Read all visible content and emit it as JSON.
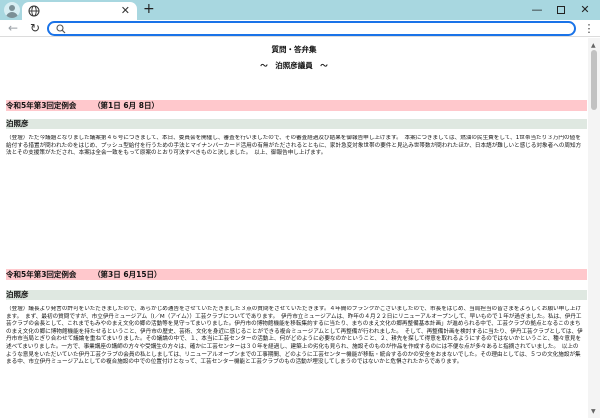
{
  "browser": {
    "tab_title": "",
    "tab_close": "✕",
    "new_tab": "+",
    "min": "—",
    "close": "✕",
    "back": "←",
    "reload": "↻",
    "menu": "⋮",
    "url_value": "",
    "icons": [
      "profile-icon",
      "globe-icon",
      "search-icon"
    ],
    "accent": "#1a73e8",
    "tabbar_color": "#a8d7e0"
  },
  "page": {
    "title": "質問・答弁集",
    "subtitle": "～　泊照彦議員　～",
    "colors": {
      "session_bg": "#ffc8cc",
      "speaker_bg": "#dfe8e1"
    },
    "sections": [
      {
        "session": "令和5年第3回定例会",
        "date": "（第1日 6月 8日）",
        "speaker": "泊照彦",
        "text": "（登壇）ただ今議題となりました議案第４６号につきまして、本日、委員会を開催し、審査を行いましたので、その審査経過及び結果を御報告申し上げます。　本案につきましては、燃油の民生費をして、1世帯当たり３万円の値を給付する措置が問われたのをはじめ、プッシュ型給付を行うための手法とマイナンバーカード活用の有無がただされるとともに、家計急変対象世帯の要件と見込み世帯数が問われたほか、日本語が難しいと感じる対象者への周知方法とその支援策がただされ、本案は全会一致をもって原案のとおり可決すべきものと決しました。　以上、御報告申し上げます。"
      },
      {
        "session": "令和5年第3回定例会",
        "date": "（第3日 6月15日）",
        "speaker": "泊照彦",
        "text": "（登壇）議長より発言の許可をいただきましたので、あらかじめ通告をさせていただきました３点の質問をさせていただきます。４年間のブランクがございましたので、市長をはじめ、当局担当の皆さまをよろしくお願い申し上げます。　まず、最初の質問ですが、市立伊丹ミュージアム（I／M（アイム））工芸クラブについてであります。　伊丹市立ミュージアムは、昨年の４月２２日にリニューアルオープンして、早いもので１年が過ぎました。私は、伊丹工芸クラブの会長として、これまでもみやのまえ文化の郷の活動等を見守ってまいりました。伊丹市の博物館機能を移転集約するに当たり、まちのまえ文化の郷再整備基本計画」が進められる中で、工芸クラブの拠点となるこのまちのまえ文化の郷に博物館機能を持たせるということ、伊丹市の歴史、芸術、文化を身近に感じることができる複合ミュージアムとして再整備が行われました。　そして、再整備計画を検討するに当たり、伊丹工芸クラブとしては、伊丹市市当局とぎり合わせて議論を重ねてまいりました。その議論の中で、１、本当に工芸センターの活動上、何がどのように必要なのかということ、２、耕先を探して得意を取れるようにするのではないかということ、種々意見を述べてまいりました。一方で、事業講座の講師の方々や受講生の方々は、確かに工芸センターは３０年を経過し、建築上の劣化も見られ、施設そのものが作品を作成するのには不便な点が多々あると指摘されていました。　以上のような意見をいただいていた伊丹工芸クラブの会員の私としましては、リニューアルオープンまでの工事期間、どのように工芸センター機能が移転・統合するのかの安全をおまないでした。その理由としては、５つの文化施設が集まる中、市立伊丹ミュージアムとしての複合施設の中での位置付けとなって、工芸センター機能と工芸クラブのもの活動が埋没してしまうのではないかと危惧されたからであります。"
      }
    ]
  },
  "scrollbar": {
    "up": "▲",
    "down": "▼"
  }
}
